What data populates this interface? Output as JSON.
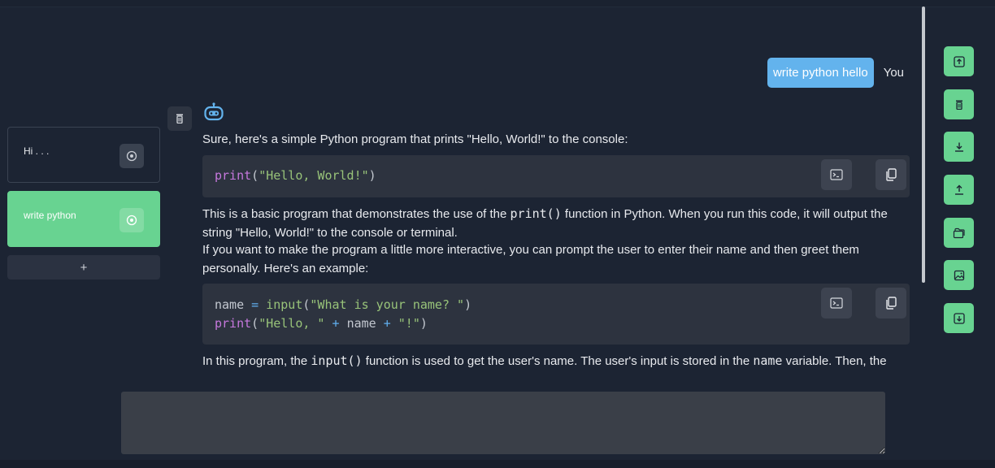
{
  "sidebar": {
    "conversations": [
      {
        "label": "Hi . . .",
        "active": false
      },
      {
        "label": "write python",
        "active": true
      }
    ],
    "add_label": "+"
  },
  "chat": {
    "user": {
      "message": "write python hello",
      "name": "You"
    },
    "bot": {
      "intro": "Sure, here's a simple Python program that prints \"Hello, World!\" to the console:",
      "code1": [
        "print(\"Hello, World!\")"
      ],
      "para2_a": "This is a basic program that demonstrates the use of the ",
      "para2_code": "print()",
      "para2_b": " function in Python. When you run this code, it will output the string \"Hello, World!\" to the console or terminal.",
      "para3": "If you want to make the program a little more interactive, you can prompt the user to enter their name and then greet them personally. Here's an example:",
      "code2": [
        "name = input(\"What is your name? \")",
        "print(\"Hello, \" + name + \"!\")"
      ],
      "para4_a": "In this program, the ",
      "para4_code1": "input()",
      "para4_b": " function is used to get the user's name. The user's input is stored in the ",
      "para4_code2": "name",
      "para4_c": " variable. Then, the"
    }
  },
  "input": {
    "value": "",
    "placeholder": ""
  },
  "toolbar": {
    "buttons": [
      "scroll-top-icon",
      "trash-icon",
      "download-icon",
      "upload-icon",
      "folder-icon",
      "image-icon",
      "scroll-bottom-icon"
    ]
  },
  "colors": {
    "accent_green": "#68d391",
    "user_bubble": "#63b3ed",
    "background": "#1c2433"
  }
}
